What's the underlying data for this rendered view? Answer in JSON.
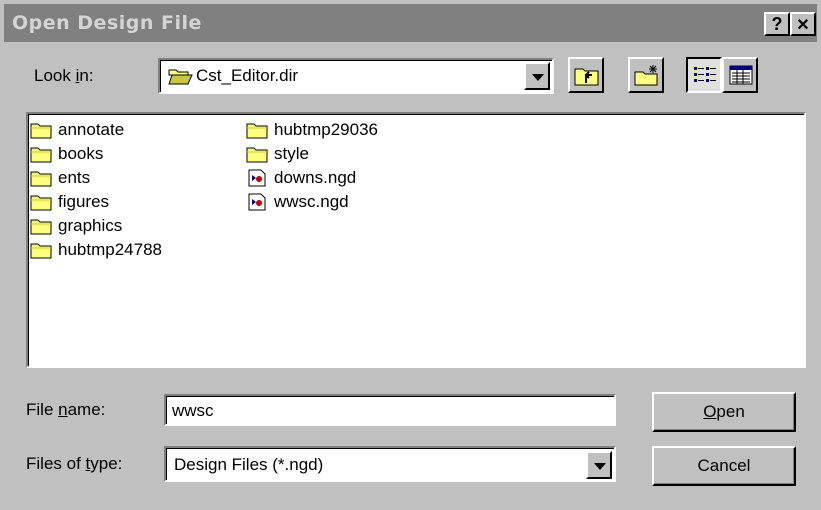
{
  "window": {
    "title": "Open Design File",
    "help_symbol": "?",
    "close_symbol": "✕"
  },
  "look_in": {
    "label_pre": "Look ",
    "label_key": "i",
    "label_post": "n:",
    "value": "Cst_Editor.dir"
  },
  "toolbar": {
    "up_one_level": "up-folder-icon",
    "create_new_folder": "new-folder-icon",
    "list_view": "list-view-icon",
    "details_view": "details-view-icon"
  },
  "files": {
    "column1": [
      {
        "name": "annotate",
        "icon": "folder-icon"
      },
      {
        "name": "books",
        "icon": "folder-icon"
      },
      {
        "name": "ents",
        "icon": "folder-icon"
      },
      {
        "name": "figures",
        "icon": "folder-icon"
      },
      {
        "name": "graphics",
        "icon": "folder-icon"
      },
      {
        "name": "hubtmp24788",
        "icon": "folder-icon"
      }
    ],
    "column2": [
      {
        "name": "hubtmp29036",
        "icon": "folder-icon"
      },
      {
        "name": "style",
        "icon": "folder-icon"
      },
      {
        "name": "downs.ngd",
        "icon": "design-file-icon"
      },
      {
        "name": "wwsc.ngd",
        "icon": "design-file-icon"
      }
    ]
  },
  "file_name": {
    "label_pre": "File ",
    "label_key": "n",
    "label_post": "ame:",
    "value": "wwsc"
  },
  "files_of_type": {
    "label_pre": "Files of ",
    "label_key": "t",
    "label_post": "ype:",
    "value": "Design Files (*.ngd)"
  },
  "buttons": {
    "open_key": "O",
    "open_rest": "pen",
    "cancel": "Cancel"
  }
}
